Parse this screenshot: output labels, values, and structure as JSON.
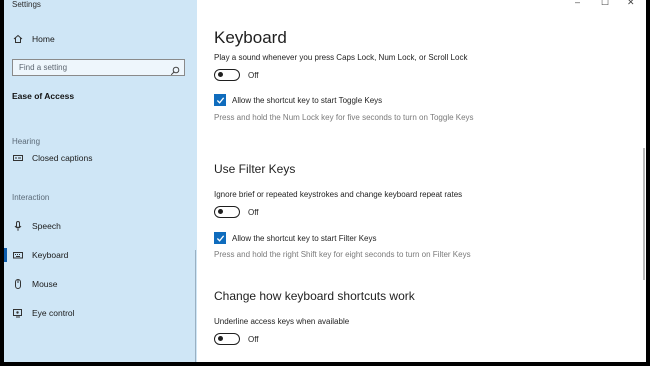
{
  "window": {
    "title": "Settings",
    "controls": [
      "–",
      "☐",
      "✕"
    ]
  },
  "sidebar": {
    "home": {
      "label": "Home",
      "icon": "home-icon"
    },
    "search": {
      "placeholder": "Find a setting",
      "icon": "search-icon"
    },
    "category": "Ease of Access",
    "groups": [
      {
        "label": "Hearing",
        "items": [
          {
            "label": "Closed captions",
            "icon": "closed-captions-icon"
          }
        ]
      },
      {
        "label": "Interaction",
        "items": [
          {
            "label": "Speech",
            "icon": "microphone-icon"
          },
          {
            "label": "Keyboard",
            "icon": "keyboard-icon",
            "selected": true
          },
          {
            "label": "Mouse",
            "icon": "mouse-icon"
          },
          {
            "label": "Eye control",
            "icon": "eye-control-icon"
          }
        ]
      }
    ]
  },
  "main": {
    "title": "Keyboard",
    "toggle_keys": {
      "sound_text": "Play a sound whenever you press Caps Lock, Num Lock, or Scroll Lock",
      "toggle_state": "Off",
      "shortcut_checkbox": "Allow the shortcut key to start Toggle Keys",
      "shortcut_checked": true,
      "help_text": "Press and hold the Num Lock key for five seconds to turn on Toggle Keys"
    },
    "filter_keys": {
      "heading": "Use Filter Keys",
      "description": "Ignore brief or repeated keystrokes and change keyboard repeat rates",
      "toggle_state": "Off",
      "shortcut_checkbox": "Allow the shortcut key to start Filter Keys",
      "shortcut_checked": true,
      "help_text": "Press and hold the right Shift key for eight seconds to turn on Filter Keys"
    },
    "shortcuts": {
      "heading": "Change how keyboard shortcuts work",
      "description": "Underline access keys when available",
      "toggle_state": "Off"
    }
  },
  "colors": {
    "sidebar_bg": "#cfe6f6",
    "accent": "#0f6cbd"
  }
}
